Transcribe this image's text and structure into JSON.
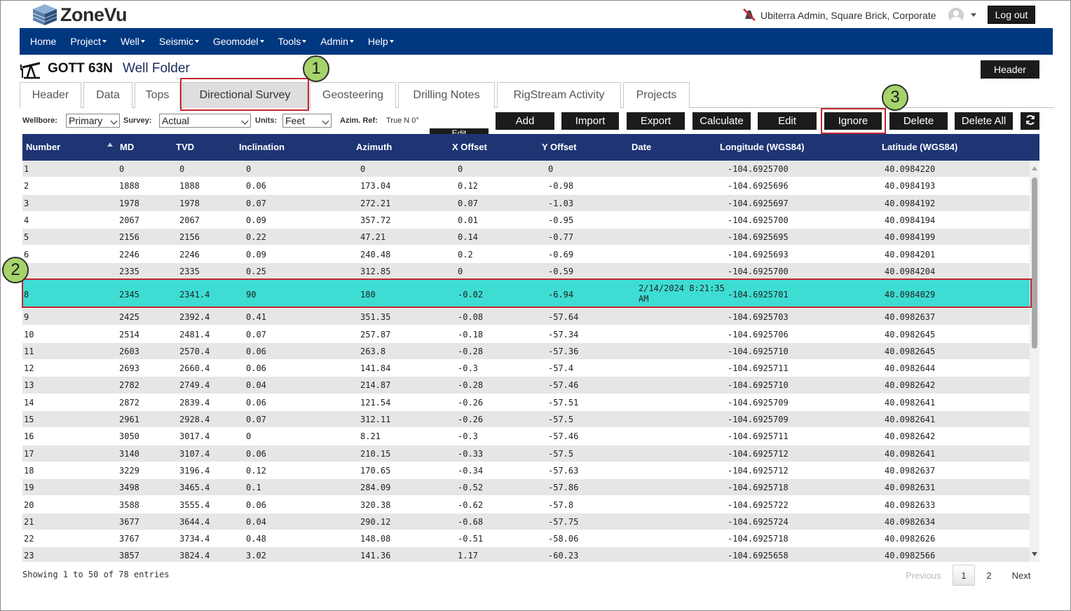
{
  "app": {
    "logo_text": "ZoneVu",
    "user_text": "Ubiterra Admin, Square Brick, Corporate",
    "logout_label": "Log out"
  },
  "nav": {
    "items": [
      "Home",
      "Project",
      "Well",
      "Seismic",
      "Geomodel",
      "Tools",
      "Admin",
      "Help"
    ]
  },
  "page": {
    "well_name": "GOTT 63N",
    "folder_label": "Well Folder",
    "header_button": "Header"
  },
  "tabs": [
    "Header",
    "Data",
    "Tops",
    "Directional Survey",
    "Geosteering",
    "Drilling Notes",
    "RigStream Activity",
    "Projects"
  ],
  "active_tab": "Directional Survey",
  "toolbar": {
    "wellbore_label": "Wellbore:",
    "wellbore_value": "Primary",
    "survey_label": "Survey:",
    "survey_value": "Actual",
    "units_label": "Units:",
    "units_value": "Feet",
    "azim_label": "Azim. Ref:",
    "azim_value": "True N 0°",
    "edit_partial_label": "Edit",
    "buttons": [
      "Add",
      "Import",
      "Export",
      "Calculate",
      "Edit",
      "Ignore",
      "Delete",
      "Delete All"
    ]
  },
  "table": {
    "columns": [
      "Number",
      "MD",
      "TVD",
      "Inclination",
      "Azimuth",
      "X Offset",
      "Y Offset",
      "Date",
      "Longitude (WGS84)",
      "Latitude (WGS84)"
    ],
    "rows": [
      [
        "1",
        "0",
        "0",
        "0",
        "0",
        "0",
        "0",
        "",
        "-104.6925700",
        "40.0984220"
      ],
      [
        "2",
        "1888",
        "1888",
        "0.06",
        "173.04",
        "0.12",
        "-0.98",
        "",
        "-104.6925696",
        "40.0984193"
      ],
      [
        "3",
        "1978",
        "1978",
        "0.07",
        "272.21",
        "0.07",
        "-1.03",
        "",
        "-104.6925697",
        "40.0984192"
      ],
      [
        "4",
        "2067",
        "2067",
        "0.09",
        "357.72",
        "0.01",
        "-0.95",
        "",
        "-104.6925700",
        "40.0984194"
      ],
      [
        "5",
        "2156",
        "2156",
        "0.22",
        "47.21",
        "0.14",
        "-0.77",
        "",
        "-104.6925695",
        "40.0984199"
      ],
      [
        "6",
        "2246",
        "2246",
        "0.09",
        "240.48",
        "0.2",
        "-0.69",
        "",
        "-104.6925693",
        "40.0984201"
      ],
      [
        "7",
        "2335",
        "2335",
        "0.25",
        "312.85",
        "0",
        "-0.59",
        "",
        "-104.6925700",
        "40.0984204"
      ],
      [
        "8",
        "2345",
        "2341.4",
        "90",
        "180",
        "-0.02",
        "-6.94",
        "2/14/2024 8:21:35 AM",
        "-104.6925701",
        "40.0984029"
      ],
      [
        "9",
        "2425",
        "2392.4",
        "0.41",
        "351.35",
        "-0.08",
        "-57.64",
        "",
        "-104.6925703",
        "40.0982637"
      ],
      [
        "10",
        "2514",
        "2481.4",
        "0.07",
        "257.87",
        "-0.18",
        "-57.34",
        "",
        "-104.6925706",
        "40.0982645"
      ],
      [
        "11",
        "2603",
        "2570.4",
        "0.06",
        "263.8",
        "-0.28",
        "-57.36",
        "",
        "-104.6925710",
        "40.0982645"
      ],
      [
        "12",
        "2693",
        "2660.4",
        "0.06",
        "141.84",
        "-0.3",
        "-57.4",
        "",
        "-104.6925711",
        "40.0982644"
      ],
      [
        "13",
        "2782",
        "2749.4",
        "0.04",
        "214.87",
        "-0.28",
        "-57.46",
        "",
        "-104.6925710",
        "40.0982642"
      ],
      [
        "14",
        "2872",
        "2839.4",
        "0.06",
        "121.54",
        "-0.26",
        "-57.51",
        "",
        "-104.6925709",
        "40.0982641"
      ],
      [
        "15",
        "2961",
        "2928.4",
        "0.07",
        "312.11",
        "-0.26",
        "-57.5",
        "",
        "-104.6925709",
        "40.0982641"
      ],
      [
        "16",
        "3050",
        "3017.4",
        "0",
        "8.21",
        "-0.3",
        "-57.46",
        "",
        "-104.6925711",
        "40.0982642"
      ],
      [
        "17",
        "3140",
        "3107.4",
        "0.06",
        "210.15",
        "-0.33",
        "-57.5",
        "",
        "-104.6925712",
        "40.0982641"
      ],
      [
        "18",
        "3229",
        "3196.4",
        "0.12",
        "170.65",
        "-0.34",
        "-57.63",
        "",
        "-104.6925712",
        "40.0982637"
      ],
      [
        "19",
        "3498",
        "3465.4",
        "0.1",
        "284.09",
        "-0.52",
        "-57.86",
        "",
        "-104.6925718",
        "40.0982631"
      ],
      [
        "20",
        "3588",
        "3555.4",
        "0.06",
        "320.38",
        "-0.62",
        "-57.8",
        "",
        "-104.6925722",
        "40.0982633"
      ],
      [
        "21",
        "3677",
        "3644.4",
        "0.04",
        "290.12",
        "-0.68",
        "-57.75",
        "",
        "-104.6925724",
        "40.0982634"
      ],
      [
        "22",
        "3767",
        "3734.4",
        "0.48",
        "148.08",
        "-0.51",
        "-58.06",
        "",
        "-104.6925718",
        "40.0982626"
      ],
      [
        "23",
        "3857",
        "3824.4",
        "3.02",
        "141.36",
        "1.17",
        "-60.23",
        "",
        "-104.6925658",
        "40.0982566"
      ]
    ]
  },
  "footer": {
    "showing": "Showing 1 to 50 of 78 entries",
    "previous": "Previous",
    "pages": [
      "1",
      "2"
    ],
    "next": "Next"
  },
  "callouts": [
    "1",
    "2",
    "3"
  ],
  "colors": {
    "nav_bg": "#003880",
    "table_header": "#1e3473",
    "selected_row": "#3dddd3",
    "callout_border": "#c4262e",
    "badge": "#a6d36b"
  }
}
